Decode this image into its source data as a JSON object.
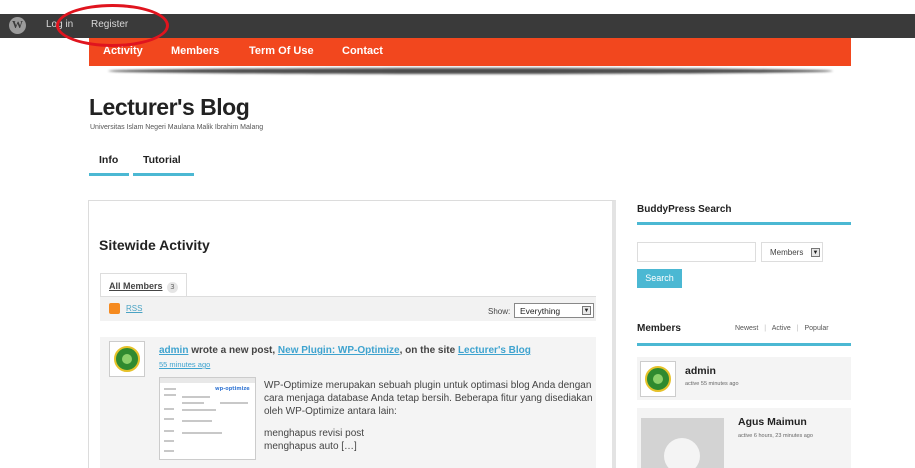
{
  "admin_bar": {
    "logo_icon": "wordpress-logo-icon",
    "login_label": "Log in",
    "register_label": "Register"
  },
  "nav": {
    "items": [
      "Activity",
      "Members",
      "Term Of Use",
      "Contact"
    ],
    "color": "#f2471e"
  },
  "site": {
    "title": "Lecturer's Blog",
    "description": "Universitas Islam Negeri Maulana Malik Ibrahim Malang"
  },
  "subnav": {
    "items": [
      "Info",
      "Tutorial"
    ],
    "accent": "#4bb8d3"
  },
  "activity": {
    "title": "Sitewide Activity",
    "tab_label": "All Members",
    "tab_count": "3",
    "rss_label": "RSS",
    "show_label": "Show:",
    "show_value": "Everything",
    "item": {
      "author": "admin",
      "action_text": " wrote a new post, ",
      "post_title": "New Plugin: WP-Optimize",
      "site_prefix": ", on the site ",
      "site_name": "Lecturer's Blog",
      "time": "55 minutes ago",
      "thumb_logo": "wp-optimize",
      "excerpt": "WP-Optimize merupakan sebuah plugin untuk optimasi blog Anda dengan cara menjaga database Anda tetap bersih. Beberapa fitur yang disediakan oleh WP-Optimize antara lain:",
      "line1": "menghapus revisi post",
      "line2": "menghapus auto […]"
    }
  },
  "sidebar": {
    "search_title": "BuddyPress Search",
    "search_select": "Members",
    "search_button": "Search",
    "members_title": "Members",
    "filter_newest": "Newest",
    "filter_active": "Active",
    "filter_popular": "Popular",
    "separator": "|",
    "members": [
      {
        "name": "admin",
        "active": "active 55 minutes ago"
      },
      {
        "name": "Agus Maimun",
        "active": "active 6 hours, 23 minutes ago"
      }
    ]
  }
}
